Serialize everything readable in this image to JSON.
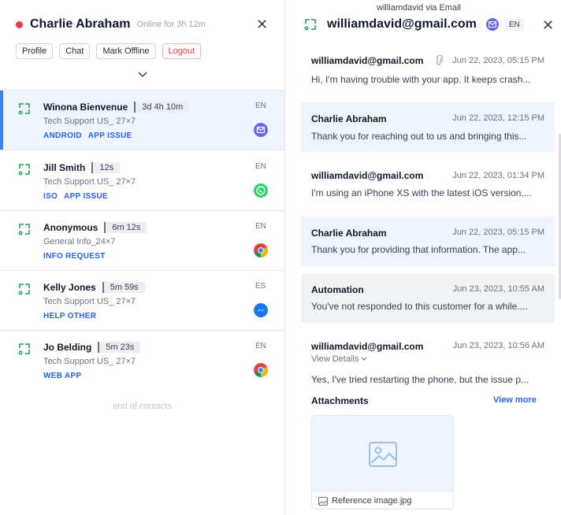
{
  "agent": {
    "name": "Charlie Abraham",
    "status": "Online for 3h 12m",
    "status_color": "#e53e3e",
    "buttons": [
      "Profile",
      "Chat",
      "Mark Offline",
      "Logout"
    ]
  },
  "contacts": [
    {
      "name": "Winona Bienvenue",
      "time": "3d 4h 10m",
      "queue": "Tech Support US_ 27×7",
      "tags": [
        "ANDROID",
        "APP ISSUE"
      ],
      "lang": "EN",
      "channel": "email-icon"
    },
    {
      "name": "Jill Smith",
      "time": "12s",
      "queue": "Tech Support US_ 27×7",
      "tags": [
        "ISO",
        "APP ISSUE"
      ],
      "lang": "EN",
      "channel": "whatsapp-icon"
    },
    {
      "name": "Anonymous",
      "time": "6m 12s",
      "queue": "General Info_24×7",
      "tags": [
        "INFO REQUEST"
      ],
      "lang": "EN",
      "channel": "chrome-icon"
    },
    {
      "name": "Kelly Jones",
      "time": "5m 59s",
      "queue": "Tech Support US_ 27×7",
      "tags": [
        "HELP OTHER"
      ],
      "lang": "ES",
      "channel": "messenger-icon"
    },
    {
      "name": "Jo Belding",
      "time": "5m 23s",
      "queue": "Tech Support US_ 27×7",
      "tags": [
        "WEB APP"
      ],
      "lang": "EN",
      "channel": "chrome-icon"
    }
  ],
  "end_of_contacts": "end of contacts",
  "conversation": {
    "subtitle": "williamdavid via Email",
    "title": "williamdavid@gmail.com",
    "lang": "EN",
    "messages": [
      {
        "from": "williamdavid@gmail.com",
        "date": "Jun 22, 2023, 05:15 PM",
        "text": "Hi, I'm having trouble with your app. It keeps crash..."
      },
      {
        "from": "Charlie Abraham",
        "date": "Jun 22, 2023, 12:15 PM",
        "text": "Thank you for reaching out to us and bringing this..."
      },
      {
        "from": "williamdavid@gmail.com",
        "date": "Jun 22, 2023, 01:34 PM",
        "text": "I'm using an iPhone XS with the latest iOS version,..."
      },
      {
        "from": "Charlie Abraham",
        "date": "Jun 22, 2023, 05:15 PM",
        "text": "Thank you for providing that information. The app..."
      },
      {
        "from": "Automation",
        "date": "Jun 23, 2023, 10:55 AM",
        "text": "You've not responded to this customer for a while...."
      },
      {
        "from": "williamdavid@gmail.com",
        "date": "Jun 23, 2023, 10:56 AM",
        "view_details": "View Details",
        "text": "Yes, I've tried restarting the phone, but the issue p..."
      }
    ],
    "attachments_label": "Attachments",
    "view_more": "View more",
    "attachment_name": "Reference image.jpg"
  }
}
